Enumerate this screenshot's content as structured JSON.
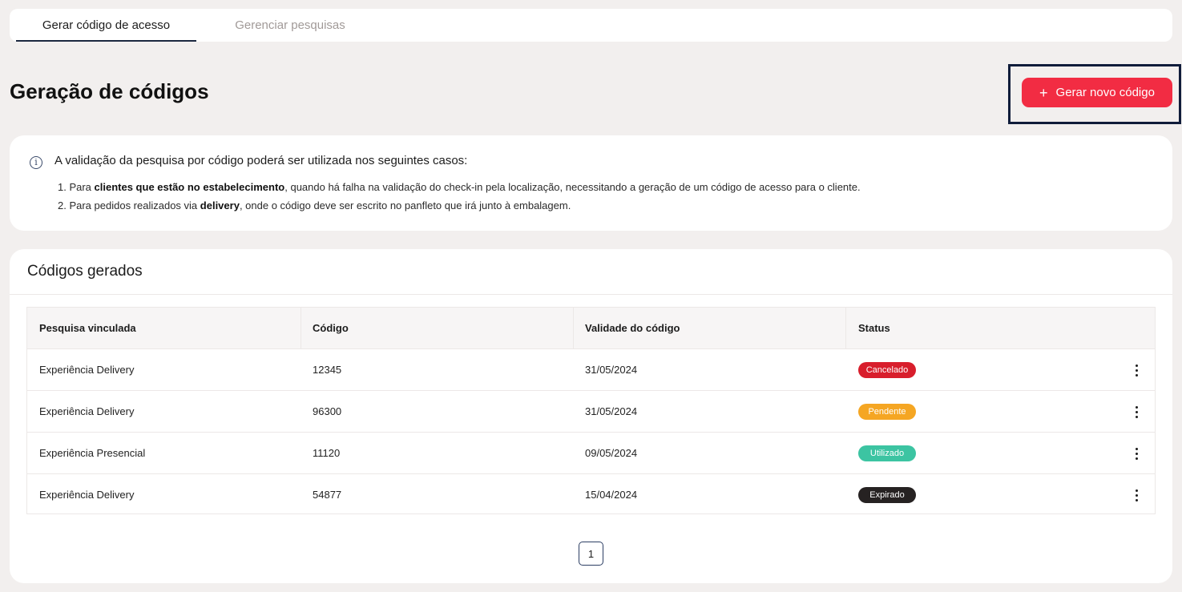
{
  "tabs": [
    {
      "label": "Gerar código de acesso",
      "active": true
    },
    {
      "label": "Gerenciar pesquisas",
      "active": false
    }
  ],
  "header": {
    "title": "Geração de códigos",
    "new_code_button": "Gerar novo código",
    "button_icon": "plus-icon"
  },
  "info": {
    "icon": "info-icon",
    "heading": "A validação da pesquisa por código poderá ser utilizada nos seguintes casos:",
    "items": [
      {
        "prefix": "1. Para ",
        "bold": "clientes que estão no estabelecimento",
        "suffix": ", quando há falha na validação do check-in pela localização, necessitando a geração de um código de acesso para o cliente."
      },
      {
        "prefix": "2. Para pedidos realizados via ",
        "bold": "delivery",
        "suffix": ", onde o código deve ser escrito no panfleto que irá junto à embalagem."
      }
    ]
  },
  "codes": {
    "title": "Códigos gerados",
    "columns": [
      "Pesquisa vinculada",
      "Código",
      "Validade do código",
      "Status"
    ],
    "rows": [
      {
        "survey": "Experiência Delivery",
        "code": "12345",
        "validity": "31/05/2024",
        "status": "Cancelado",
        "status_color": "#d81e2c"
      },
      {
        "survey": "Experiência Delivery",
        "code": "96300",
        "validity": "31/05/2024",
        "status": "Pendente",
        "status_color": "#f5a623"
      },
      {
        "survey": "Experiência Presencial",
        "code": "11120",
        "validity": "09/05/2024",
        "status": "Utilizado",
        "status_color": "#3cc4a2"
      },
      {
        "survey": "Experiência Delivery",
        "code": "54877",
        "validity": "15/04/2024",
        "status": "Expirado",
        "status_color": "#262222"
      }
    ]
  },
  "pagination": {
    "current_page": "1"
  },
  "colors": {
    "accent": "#f22c43",
    "background": "#f2efee",
    "highlight_border": "#101c3a"
  }
}
